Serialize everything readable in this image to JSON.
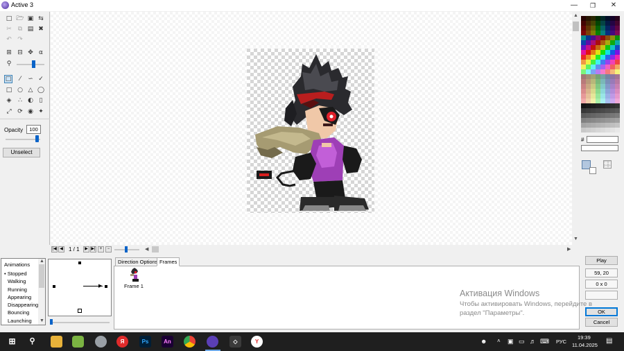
{
  "window": {
    "title": "Active 3"
  },
  "toolbox": {
    "opacity_label": "Opacity",
    "opacity_value": "100",
    "opacity_fraction": 1.0,
    "unselect_label": "Unselect"
  },
  "frame_nav": {
    "counter": "1 / 1"
  },
  "palette": {
    "hash_label": "#",
    "hex_value": ""
  },
  "animations": {
    "header": "Animations",
    "selected_marker": "•",
    "items": [
      "Stopped",
      "Walking",
      "Running",
      "Appearing",
      "Disappearing",
      "Bouncing",
      "Launching"
    ],
    "selected_index": 0
  },
  "tabs": {
    "direction_options": "Direction Options",
    "frames": "Frames"
  },
  "frames": {
    "frame_1_label": "Frame 1"
  },
  "watermark": {
    "title": "Активация Windows",
    "line1": "Чтобы активировать Windows, перейдите в",
    "line2": "раздел \"Параметры\"."
  },
  "right_controls": {
    "play": "Play",
    "hotspot": "59, 20",
    "action_point": "0 x 0",
    "ok": "OK",
    "cancel": "Cancel"
  },
  "taskbar": {
    "language": "РУС",
    "time": "19:39",
    "date": "11.04.2025"
  }
}
